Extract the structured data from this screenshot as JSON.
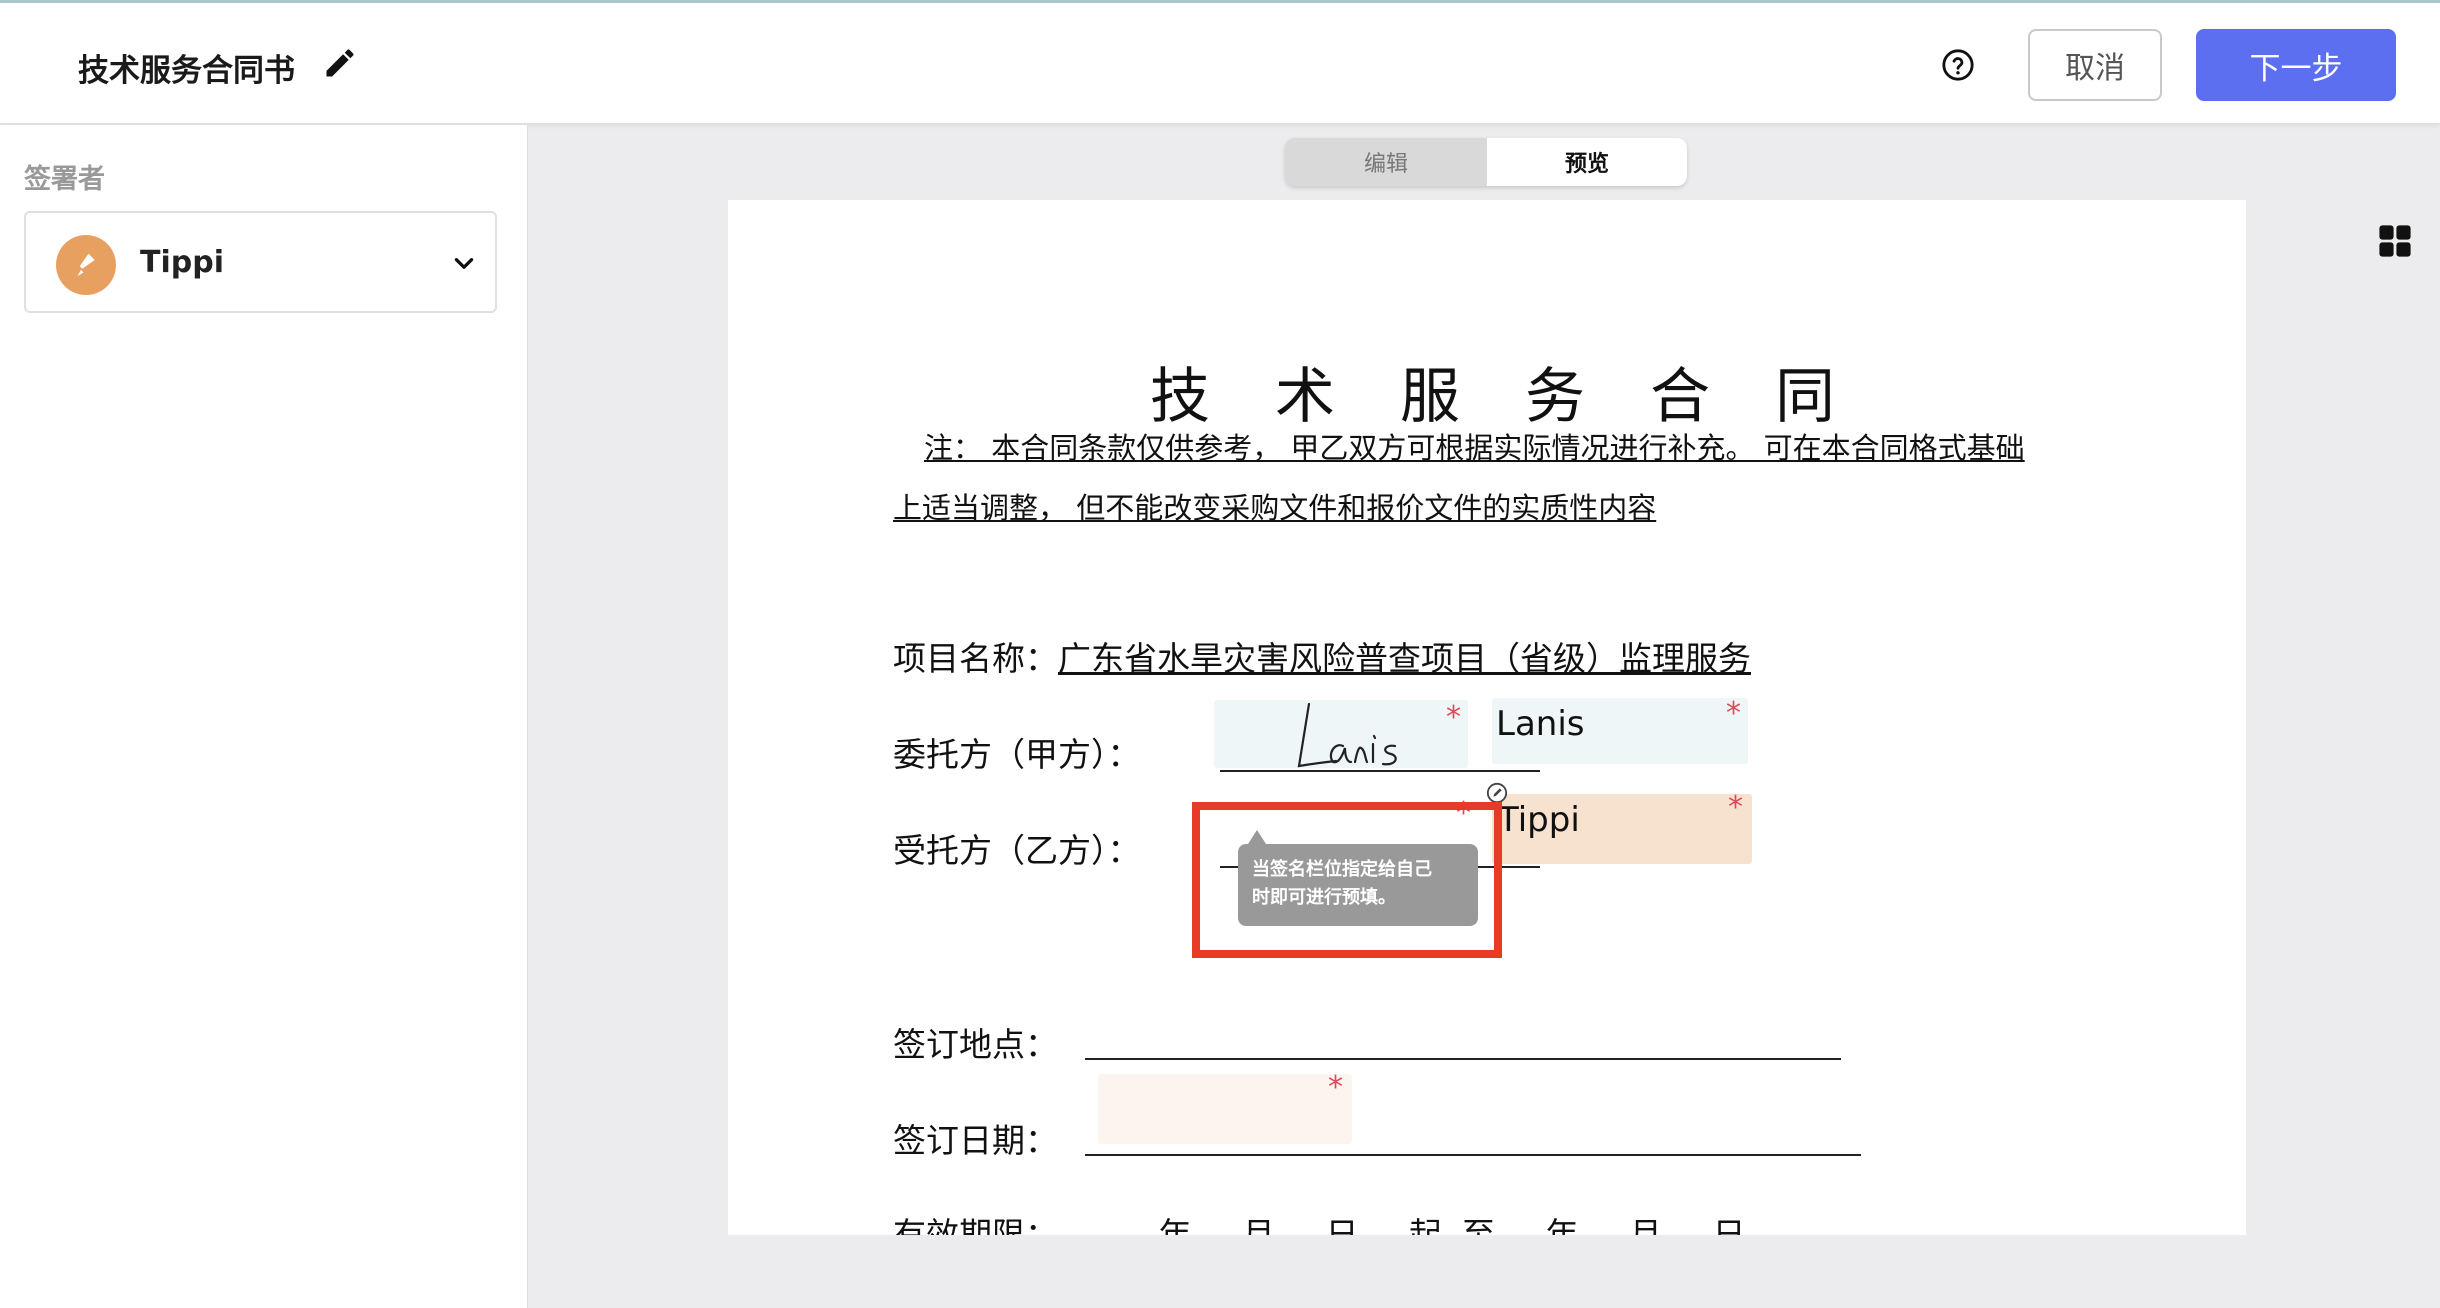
{
  "header": {
    "title": "技术服务合同书",
    "cancel_label": "取消",
    "next_label": "下一步"
  },
  "sidebar": {
    "signer_label": "签署者",
    "signer_name": "Tippi"
  },
  "view_toggle": {
    "edit_label": "编辑",
    "preview_label": "预览",
    "active": "预览"
  },
  "document": {
    "title": "技术服务合同",
    "note_line1": "注： 本合同条款仅供参考， 甲乙双方可根据实际情况进行补充。 可在本合同格式基础",
    "note_line2": "上适当调整， 但不能改变采购文件和报价文件的实质性内容",
    "project_label": "项目名称：",
    "project_value": "广东省水旱灾害风险普查项目（省级）监理服务 ",
    "party_a_label": "委托方（甲方）：",
    "party_b_label": "受托方（乙方）：",
    "sign_place_label": "签订地点：",
    "sign_date_label": "签订日期：",
    "validity_label": "有效期限：",
    "validity_text": "年 月 日 起至 年 月 日",
    "party_a_name": "Lanis",
    "party_b_name": "Tippi",
    "required_mark": "*"
  },
  "tooltip": {
    "text_line1": "当签名栏位指定给自己",
    "text_line2": "时即可进行预填。"
  },
  "colors": {
    "primary": "#5b6ff0",
    "highlight": "#e53b27",
    "required": "#e0475b",
    "field_blue": "#eef6f8",
    "field_orange": "#f7e2d0",
    "avatar": "#e8a060"
  }
}
